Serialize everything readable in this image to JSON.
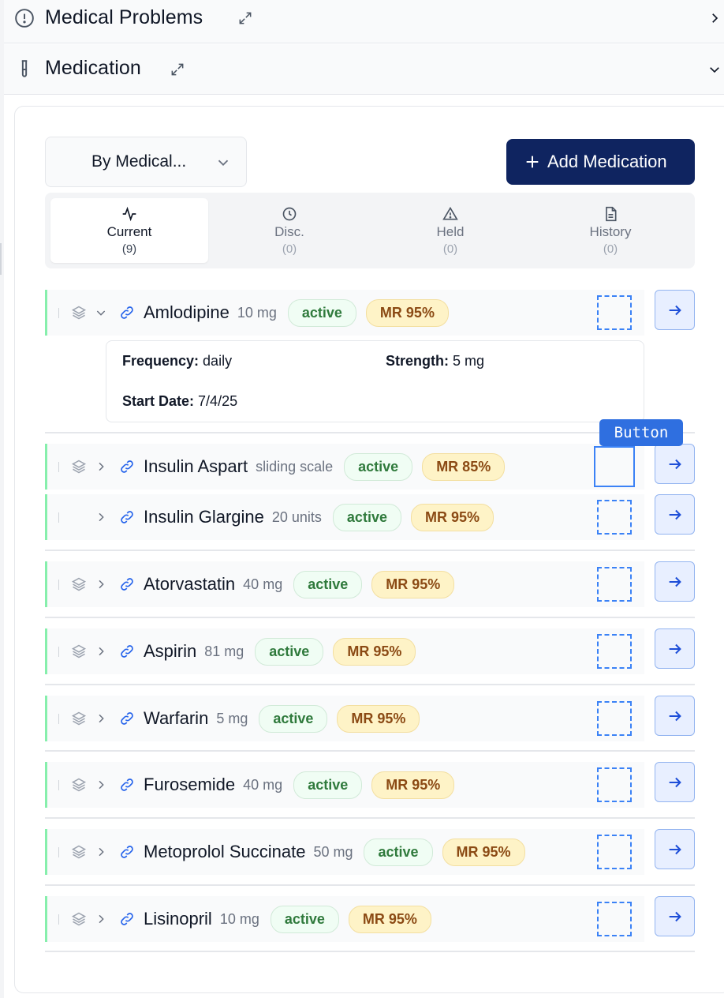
{
  "sections": {
    "problems": {
      "title": "Medical Problems"
    },
    "medication": {
      "title": "Medication"
    }
  },
  "toolbar": {
    "group_by_value": "By Medical...",
    "add_label": "Add Medication"
  },
  "tabs": [
    {
      "label": "Current",
      "count": "(9)",
      "icon": "activity-icon",
      "active": true
    },
    {
      "label": "Disc.",
      "count": "(0)",
      "icon": "clock-icon",
      "active": false
    },
    {
      "label": "Held",
      "count": "(0)",
      "icon": "warning-icon",
      "active": false
    },
    {
      "label": "History",
      "count": "(0)",
      "icon": "document-icon",
      "active": false
    }
  ],
  "medications": [
    {
      "name": "Amlodipine",
      "dose": "10 mg",
      "status": "active",
      "match": "MR 95%"
    },
    {
      "name": "Insulin Aspart",
      "dose": "sliding scale",
      "status": "active",
      "match": "MR 85%"
    },
    {
      "name": "Insulin Glargine",
      "dose": "20 units",
      "status": "active",
      "match": "MR 95%"
    },
    {
      "name": "Atorvastatin",
      "dose": "40 mg",
      "status": "active",
      "match": "MR 95%"
    },
    {
      "name": "Aspirin",
      "dose": "81 mg",
      "status": "active",
      "match": "MR 95%"
    },
    {
      "name": "Warfarin",
      "dose": "5 mg",
      "status": "active",
      "match": "MR 95%"
    },
    {
      "name": "Furosemide",
      "dose": "40 mg",
      "status": "active",
      "match": "MR 95%"
    },
    {
      "name": "Metoprolol Succinate",
      "dose": "50 mg",
      "status": "active",
      "match": "MR 95%"
    },
    {
      "name": "Lisinopril",
      "dose": "10 mg",
      "status": "active",
      "match": "MR 95%"
    }
  ],
  "details": {
    "frequency_label": "Frequency:",
    "frequency_value": "daily",
    "strength_label": "Strength:",
    "strength_value": "5 mg",
    "start_label": "Start Date:",
    "start_value": "7/4/25"
  },
  "tooltip": {
    "text": "Button"
  },
  "colors": {
    "primary": "#0f2460",
    "active_text": "#2f7a3c",
    "match_bg": "#fef3c7",
    "match_text": "#8b4a14",
    "accent_blue": "#3b82f6",
    "row_accent": "#86efac"
  }
}
